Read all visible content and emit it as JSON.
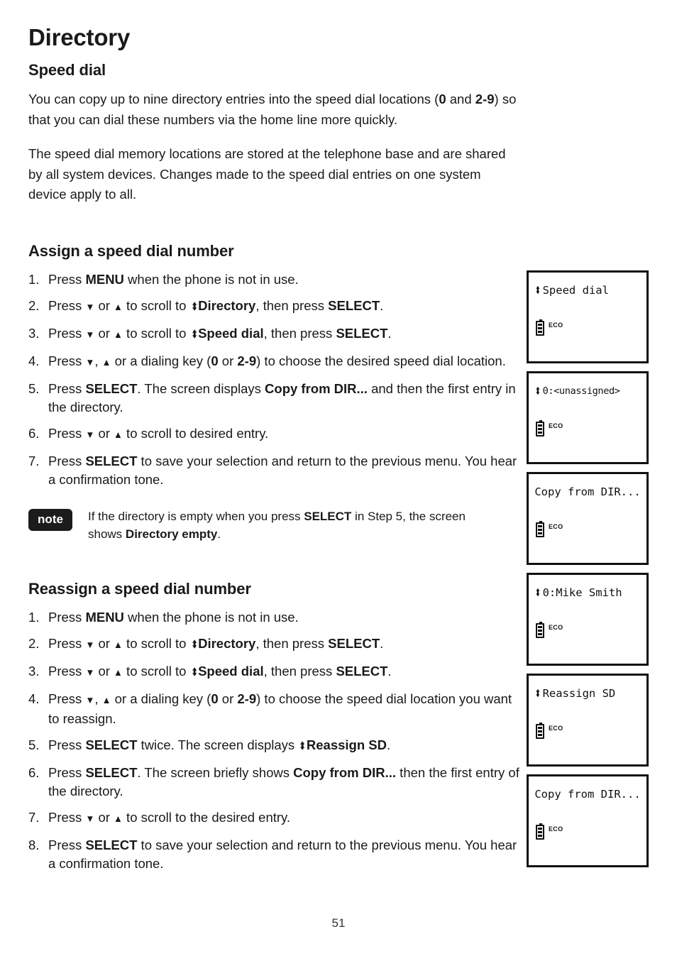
{
  "document": {
    "title": "Directory",
    "page_number": "51"
  },
  "sections": {
    "speed_dial": {
      "heading": "Speed dial",
      "paragraphs": [
        {
          "parts": [
            {
              "t": "You can copy up to nine directory entries into the speed dial locations (",
              "b": false
            },
            {
              "t": "0",
              "b": true
            },
            {
              "t": " and ",
              "b": false
            },
            {
              "t": "2-9",
              "b": true
            },
            {
              "t": ") so that you can dial these numbers via the home line more quickly.",
              "b": false
            }
          ]
        },
        {
          "parts": [
            {
              "t": "The speed dial memory locations are stored at the telephone base and are shared by all system devices. Changes made to the speed dial entries on one system device apply to all.",
              "b": false
            }
          ]
        }
      ]
    },
    "assign": {
      "heading": "Assign a speed dial number",
      "steps": [
        {
          "num": "1.",
          "parts": [
            {
              "t": "Press ",
              "b": false
            },
            {
              "t": "MENU",
              "b": true
            },
            {
              "t": " when the phone is not in use.",
              "b": false
            }
          ]
        },
        {
          "num": "2.",
          "parts": [
            {
              "t": "Press ",
              "b": false
            },
            {
              "t": "▼",
              "b": false,
              "icon": "down-arrow"
            },
            {
              "t": " or ",
              "b": false
            },
            {
              "t": "▲",
              "b": false,
              "icon": "up-arrow"
            },
            {
              "t": " to scroll to ",
              "b": false
            },
            {
              "t": "⬍",
              "b": true,
              "icon": "up-down-arrow"
            },
            {
              "t": "Directory",
              "b": true
            },
            {
              "t": ", then press ",
              "b": false
            },
            {
              "t": "SELECT",
              "b": true
            },
            {
              "t": ".",
              "b": false
            }
          ]
        },
        {
          "num": "3.",
          "parts": [
            {
              "t": "Press ",
              "b": false
            },
            {
              "t": "▼",
              "b": false,
              "icon": "down-arrow"
            },
            {
              "t": " or ",
              "b": false
            },
            {
              "t": "▲",
              "b": false,
              "icon": "up-arrow"
            },
            {
              "t": " to scroll to ",
              "b": false
            },
            {
              "t": "⬍",
              "b": true,
              "icon": "up-down-arrow"
            },
            {
              "t": "Speed dial",
              "b": true
            },
            {
              "t": ", then press ",
              "b": false
            },
            {
              "t": "SELECT",
              "b": true
            },
            {
              "t": ".",
              "b": false
            }
          ]
        },
        {
          "num": "4.",
          "parts": [
            {
              "t": "Press ",
              "b": false
            },
            {
              "t": "▼",
              "b": false,
              "icon": "down-arrow"
            },
            {
              "t": ", ",
              "b": false
            },
            {
              "t": "▲",
              "b": false,
              "icon": "up-arrow"
            },
            {
              "t": " or a dialing key (",
              "b": false
            },
            {
              "t": "0",
              "b": true
            },
            {
              "t": " or ",
              "b": false
            },
            {
              "t": "2-9",
              "b": true
            },
            {
              "t": ") to choose the desired speed dial location.",
              "b": false
            }
          ]
        },
        {
          "num": "5.",
          "parts": [
            {
              "t": "Press ",
              "b": false
            },
            {
              "t": "SELECT",
              "b": true
            },
            {
              "t": ". The screen displays ",
              "b": false
            },
            {
              "t": "Copy from DIR...",
              "b": true
            },
            {
              "t": " and then the first entry in the directory.",
              "b": false
            }
          ]
        },
        {
          "num": "6.",
          "parts": [
            {
              "t": "Press ",
              "b": false
            },
            {
              "t": "▼",
              "b": false,
              "icon": "down-arrow"
            },
            {
              "t": " or ",
              "b": false
            },
            {
              "t": "▲",
              "b": false,
              "icon": "up-arrow"
            },
            {
              "t": " to scroll to desired entry.",
              "b": false
            }
          ]
        },
        {
          "num": "7.",
          "parts": [
            {
              "t": "Press ",
              "b": false
            },
            {
              "t": "SELECT",
              "b": true
            },
            {
              "t": " to save your selection and return to the previous menu. You hear a confirmation tone.",
              "b": false
            }
          ]
        }
      ],
      "note": {
        "badge": "note",
        "parts": [
          {
            "t": "If the directory is empty when you press ",
            "b": false
          },
          {
            "t": "SELECT",
            "b": true
          },
          {
            "t": " in Step 5, the screen shows ",
            "b": false
          },
          {
            "t": "Directory empty",
            "b": true
          },
          {
            "t": ".",
            "b": false
          }
        ]
      }
    },
    "reassign": {
      "heading": "Reassign a speed dial number",
      "steps": [
        {
          "num": "1.",
          "parts": [
            {
              "t": "Press ",
              "b": false
            },
            {
              "t": "MENU",
              "b": true
            },
            {
              "t": " when the phone is not in use.",
              "b": false
            }
          ]
        },
        {
          "num": "2.",
          "parts": [
            {
              "t": "Press ",
              "b": false
            },
            {
              "t": "▼",
              "b": false,
              "icon": "down-arrow"
            },
            {
              "t": " or ",
              "b": false
            },
            {
              "t": "▲",
              "b": false,
              "icon": "up-arrow"
            },
            {
              "t": " to scroll to ",
              "b": false
            },
            {
              "t": "⬍",
              "b": true,
              "icon": "up-down-arrow"
            },
            {
              "t": "Directory",
              "b": true
            },
            {
              "t": ", then press ",
              "b": false
            },
            {
              "t": "SELECT",
              "b": true
            },
            {
              "t": ".",
              "b": false
            }
          ]
        },
        {
          "num": "3.",
          "parts": [
            {
              "t": "Press ",
              "b": false
            },
            {
              "t": "▼",
              "b": false,
              "icon": "down-arrow"
            },
            {
              "t": " or ",
              "b": false
            },
            {
              "t": "▲",
              "b": false,
              "icon": "up-arrow"
            },
            {
              "t": " to scroll to ",
              "b": false
            },
            {
              "t": "⬍",
              "b": true,
              "icon": "up-down-arrow"
            },
            {
              "t": "Speed dial",
              "b": true
            },
            {
              "t": ", then press ",
              "b": false
            },
            {
              "t": "SELECT",
              "b": true
            },
            {
              "t": ".",
              "b": false
            }
          ]
        },
        {
          "num": "4.",
          "parts": [
            {
              "t": "Press ",
              "b": false
            },
            {
              "t": "▼",
              "b": false,
              "icon": "down-arrow"
            },
            {
              "t": ", ",
              "b": false
            },
            {
              "t": "▲",
              "b": false,
              "icon": "up-arrow"
            },
            {
              "t": " or a dialing key (",
              "b": false
            },
            {
              "t": "0",
              "b": true
            },
            {
              "t": " or ",
              "b": false
            },
            {
              "t": "2-9",
              "b": true
            },
            {
              "t": ") to choose the speed dial location you want to reassign.",
              "b": false
            }
          ]
        },
        {
          "num": "5.",
          "parts": [
            {
              "t": "Press ",
              "b": false
            },
            {
              "t": "SELECT",
              "b": true
            },
            {
              "t": " twice. The screen displays ",
              "b": false
            },
            {
              "t": "⬍",
              "b": true,
              "icon": "up-down-arrow"
            },
            {
              "t": "Reassign SD",
              "b": true
            },
            {
              "t": ".",
              "b": false
            }
          ]
        },
        {
          "num": "6.",
          "parts": [
            {
              "t": "Press ",
              "b": false
            },
            {
              "t": "SELECT",
              "b": true
            },
            {
              "t": ". The screen briefly shows ",
              "b": false
            },
            {
              "t": "Copy from DIR...",
              "b": true
            },
            {
              "t": " then the first entry of the directory.",
              "b": false
            }
          ]
        },
        {
          "num": "7.",
          "parts": [
            {
              "t": "Press ",
              "b": false
            },
            {
              "t": "▼",
              "b": false,
              "icon": "down-arrow"
            },
            {
              "t": " or ",
              "b": false
            },
            {
              "t": "▲",
              "b": false,
              "icon": "up-arrow"
            },
            {
              "t": " to scroll to the desired entry.",
              "b": false
            }
          ]
        },
        {
          "num": "8.",
          "parts": [
            {
              "t": "Press ",
              "b": false
            },
            {
              "t": "SELECT",
              "b": true
            },
            {
              "t": " to save your selection and return to the previous menu. You hear a confirmation tone.",
              "b": false
            }
          ]
        }
      ]
    }
  },
  "lcd_screens": [
    {
      "arrow": true,
      "text": "Speed dial",
      "align": "left",
      "small": false,
      "battery": "battery-icon",
      "eco": "ECO"
    },
    {
      "arrow": true,
      "text": "0:<unassigned>",
      "align": "left",
      "small": true,
      "battery": "battery-icon",
      "eco": "ECO"
    },
    {
      "arrow": false,
      "text": "Copy from DIR...",
      "align": "center",
      "small": false,
      "battery": "battery-icon",
      "eco": "ECO"
    },
    {
      "arrow": true,
      "text": "0:Mike Smith",
      "align": "left",
      "small": false,
      "battery": "battery-icon",
      "eco": "ECO"
    },
    {
      "arrow": true,
      "text": "Reassign SD",
      "align": "left",
      "small": false,
      "battery": "battery-icon",
      "eco": "ECO"
    },
    {
      "arrow": false,
      "text": "Copy from DIR...",
      "align": "center",
      "small": false,
      "battery": "battery-icon",
      "eco": "ECO"
    }
  ]
}
